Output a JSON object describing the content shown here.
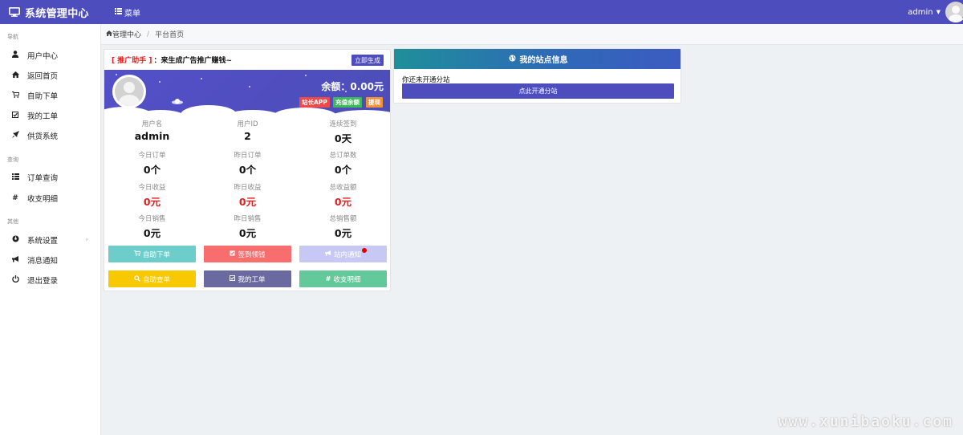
{
  "topbar": {
    "title": "系统管理中心",
    "menu_label": "菜单",
    "username": "admin"
  },
  "sidebar": {
    "groups": [
      {
        "label": "导航",
        "items": [
          {
            "label": "用户中心",
            "icon": "user-icon"
          },
          {
            "label": "返回首页",
            "icon": "home-icon"
          },
          {
            "label": "自助下单",
            "icon": "cart-icon"
          },
          {
            "label": "我的工单",
            "icon": "checkbox-icon"
          },
          {
            "label": "供货系统",
            "icon": "rocket-icon"
          }
        ]
      },
      {
        "label": "查询",
        "items": [
          {
            "label": "订单查询",
            "icon": "list-icon"
          },
          {
            "label": "收支明细",
            "icon": "hash-icon"
          }
        ]
      },
      {
        "label": "其他",
        "items": [
          {
            "label": "系统设置",
            "icon": "settings-icon"
          },
          {
            "label": "消息通知",
            "icon": "bullhorn-icon"
          },
          {
            "label": "退出登录",
            "icon": "power-icon"
          }
        ]
      }
    ]
  },
  "breadcrumb": {
    "home": "管理中心",
    "current": "平台首页"
  },
  "promo": {
    "tag": "[ 推广助手 ]",
    "text": "：来生成广告推广赚钱~",
    "generate_label": "立即生成"
  },
  "account": {
    "balance_label": "余额：0.00元",
    "app_label": "站长APP",
    "recharge_label": "充值余额",
    "withdraw_label": "提现"
  },
  "stats": [
    {
      "label": "用户名",
      "value": "admin",
      "red": false
    },
    {
      "label": "用户ID",
      "value": "2",
      "red": false
    },
    {
      "label": "连续签到",
      "value": "0天",
      "red": false
    },
    {
      "label": "今日订单",
      "value": "0个",
      "red": false
    },
    {
      "label": "昨日订单",
      "value": "0个",
      "red": false
    },
    {
      "label": "总订单数",
      "value": "0个",
      "red": false
    },
    {
      "label": "今日收益",
      "value": "0元",
      "red": true
    },
    {
      "label": "昨日收益",
      "value": "0元",
      "red": true
    },
    {
      "label": "总收益额",
      "value": "0元",
      "red": true
    },
    {
      "label": "今日销售",
      "value": "0元",
      "red": false
    },
    {
      "label": "昨日销售",
      "value": "0元",
      "red": false
    },
    {
      "label": "总销售额",
      "value": "0元",
      "red": false
    }
  ],
  "actions": [
    {
      "label": "自助下单",
      "icon": "cart-icon",
      "color": "#6ccdcb"
    },
    {
      "label": "签到领钱",
      "icon": "checkbox-icon",
      "color": "#f86d6d"
    },
    {
      "label": "站内通知",
      "icon": "bullhorn-icon",
      "color": "#c8c8f4"
    },
    {
      "label": "自助查单",
      "icon": "search-icon",
      "color": "#f8c800"
    },
    {
      "label": "我的工单",
      "icon": "checkbox-icon",
      "color": "#6a6aa0"
    },
    {
      "label": "收支明细",
      "icon": "hash-icon",
      "color": "#63c99a"
    }
  ],
  "station": {
    "title": "我的站点信息",
    "message": "你还未开通分站",
    "open_label": "点此开通分站"
  },
  "watermark": "www.xunibaoku.com",
  "colors": {
    "primary": "#4d4dbd",
    "danger": "#e02020",
    "app_tag": "#f04848",
    "recharge_tag": "#3cb95a",
    "withdraw_tag": "#f0923c"
  }
}
